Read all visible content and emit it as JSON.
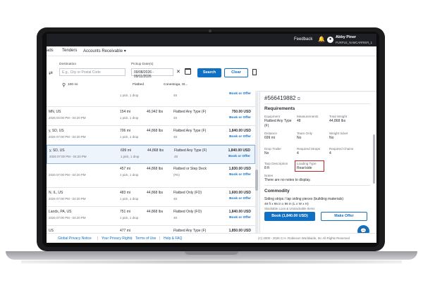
{
  "topbar": {
    "feedback": "Feedback",
    "bell_icon": "bell-icon",
    "avatar_icon": "user-icon",
    "user_name": "Abby Piner",
    "user_carrier": "PURPLE_NAMCARRIER_1"
  },
  "nav": {
    "item1": "ads",
    "item2": "Tenders",
    "item3": "Accounts Receivable",
    "chevron": "▾"
  },
  "search": {
    "destination_label": "Destination",
    "destination_placeholder": "E.g., City or Postal Code",
    "pickup_label": "Pickup Date(s)",
    "pickup_value": "09/08/2026 - 09/11/2026",
    "search_btn": "Search",
    "clear_btn": "Clear",
    "radius": "100 mi",
    "equipment": "Flatbed",
    "commodity": "Conestoga, St...",
    "date_clear": "✕",
    "calendar_icon": "calendar-icon",
    "swap_icon": "swap-arrows-icon",
    "pin_icon": "location-pin-icon",
    "bookmark_icon": "bookmark-icon"
  },
  "loads": [
    {
      "loc": "",
      "dt": "",
      "mi": "",
      "pk": "1 pick, 1 drop",
      "wt": "",
      "eq": "",
      "eq2": "48",
      "pr": "",
      "bo": "Book or Offer"
    },
    {
      "loc": "MN, US",
      "dt": "2026 04:00 PM - 04:20 PM",
      "mi": "154 mi",
      "pk": "1 pick, 1 drop",
      "wt": "46,942 lbs",
      "eq": "Flatbed Any Type (F)",
      "eq2": "48",
      "pr": "750.00 USD",
      "bo": "Book or Offer"
    },
    {
      "loc": "y, SD, US",
      "dt": "2026 07:00 PM - 04:20 PM",
      "mi": "706 mi",
      "pk": "1 pick, 1 drop",
      "wt": "44,868 lbs",
      "eq": "Flatbed Any Type (F)",
      "eq2": "48",
      "pr": "1,840.00 USD",
      "bo": "Book or Offer"
    },
    {
      "loc": "y, SD, US",
      "dt": "2026 07:00 PM - 04:20 PM",
      "mi": "699 mi",
      "pk": "1 pick, 1 drop",
      "wt": "44,868 lbs",
      "eq": "Flatbed Any Type (F)",
      "eq2": "48",
      "pr": "1,840.00 USD",
      "bo": "Book or Offer"
    },
    {
      "loc": "",
      "dt": "2026 07:00 PM - 04:20 PM",
      "mi": "457 mi",
      "pk": "1 pick, 1 drop",
      "wt": "44,868 lbs",
      "eq": "Flatbed or Step Deck",
      "eq2": "(FD)",
      "pr": "1,830.00 USD",
      "bo": "Book or Offer"
    },
    {
      "loc": "N, IL, US",
      "dt": "2026 07:00 PM - 04:20 PM",
      "mi": "483 mi",
      "pk": "1 pick, 1 drop",
      "wt": "44,868 lbs",
      "eq": "Flatbed Only (FO)",
      "eq2": "48",
      "pr": "1,600.00 USD",
      "bo": "Book or Offer"
    },
    {
      "loc": "Lands, PA, US",
      "dt": "2026 07:00 PM - 04:20 PM",
      "mi": "751 mi",
      "pk": "1 pick, 1 drop",
      "wt": "44,868 lbs",
      "eq": "Flatbed Only (FO)",
      "eq2": "48",
      "pr": "1,840.00 USD",
      "bo": "Book or Offer"
    },
    {
      "loc": "US",
      "dt": "2026 07:00 PM - 04:20 PM",
      "mi": "477 mi",
      "pk": "1 pick, 1 drop",
      "wt": "",
      "eq": "Flatbed Any Type (F)",
      "eq2": "",
      "pr": "1,850.00 USD",
      "bo": ""
    }
  ],
  "detail": {
    "load_id": "#566419882",
    "copy_icon": "copy-icon",
    "requirements_title": "Requirements",
    "equipment_label": "Equipment",
    "equipment_value": "Flatbed Any Type",
    "equipment_value2": "(F)",
    "measurements_label": "Measurements",
    "measurements_value": "48",
    "total_weight_label": "Total Weight",
    "total_weight_value": "44,868 lbs",
    "distance_label": "Distance",
    "distance_value": "699 mi",
    "team_only_label": "Team Only",
    "team_only_value": "No",
    "weight_ticket_label": "Weight ticket",
    "weight_ticket_value": "No",
    "drop_trailer_label": "Drop Trailer",
    "drop_trailer_value": "No",
    "required_straps_label": "Required Straps",
    "required_straps_value": "4",
    "required_chains_label": "Required Chains",
    "required_chains_value": "4",
    "tarp_desc_label": "Tarp Description",
    "tarp_desc_value": "8 ft",
    "loading_type_label": "Loading Type",
    "loading_type_value": "Rear/side",
    "notes_label": "Notes",
    "notes_value": "There are no notes to display.",
    "commodity_title": "Commodity",
    "commodity_line1": "Siding strips / lap siding pieces (building materials)",
    "commodity_line2": "48 ft x 96 in x 96 in (L x W x H)",
    "commodity_line3": "Stackable Loos & Unstackable Items",
    "book_btn": "Book (1,840.00 USD)",
    "offer_btn": "Make Offer",
    "chat_icon": "chat-icon"
  },
  "footer": {
    "link1": "Global Privacy Notice",
    "link2": "Your Privacy Rights",
    "link3": "Terms of Use",
    "link4": "Help & FAQ",
    "sep": "|",
    "copyright": "(C) 2000 - 2026 C.H. Robinson Worldwide, Inc All Rights Reserved"
  }
}
